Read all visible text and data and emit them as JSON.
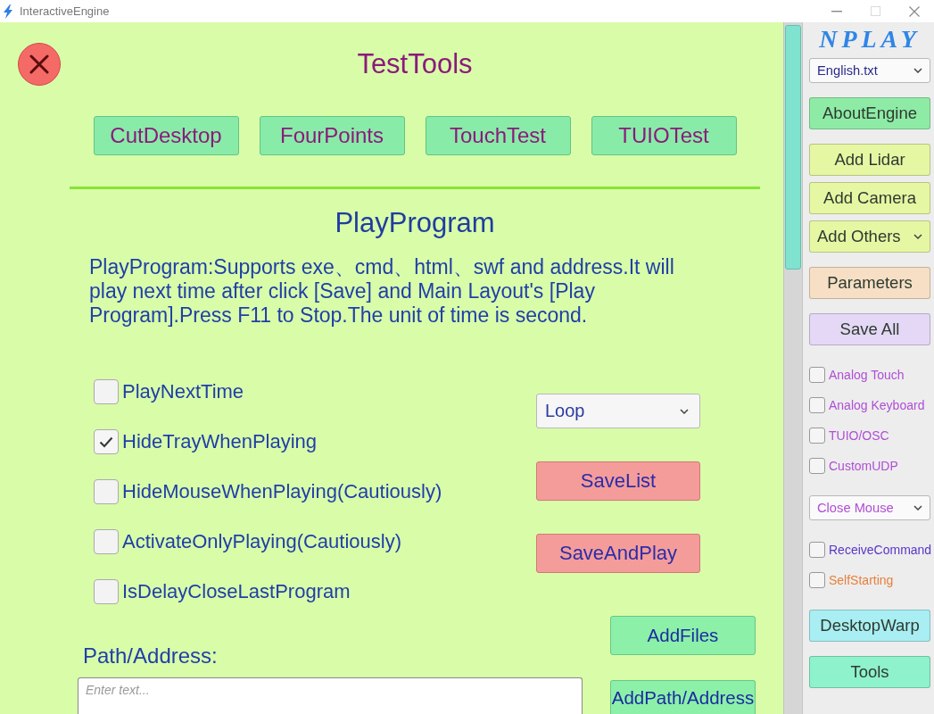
{
  "window": {
    "title": "InteractiveEngine",
    "controls": [
      {
        "kind": "minimize",
        "disabled": false
      },
      {
        "kind": "maximize",
        "disabled": true
      },
      {
        "kind": "close",
        "disabled": false
      }
    ]
  },
  "test_tools": {
    "title": "TestTools",
    "buttons": [
      "CutDesktop",
      "FourPoints",
      "TouchTest",
      "TUIOTest"
    ]
  },
  "play_program": {
    "title": "PlayProgram",
    "description": "PlayProgram:Supports exe、cmd、html、swf and address.It will play next time after click [Save] and Main Layout's [Play Program].Press F11 to Stop.The unit of time is second.",
    "options": [
      {
        "label": "PlayNextTime",
        "checked": false
      },
      {
        "label": "HideTrayWhenPlaying",
        "checked": true
      },
      {
        "label": "HideMouseWhenPlaying(Cautiously)",
        "checked": false
      },
      {
        "label": "ActivateOnlyPlaying(Cautiously)",
        "checked": false
      },
      {
        "label": "IsDelayCloseLastProgram",
        "checked": false
      }
    ],
    "mode_select": {
      "value": "Loop"
    },
    "actions": [
      "SaveList",
      "SaveAndPlay"
    ],
    "path_label": "Path/Address:",
    "path_field": {
      "placeholder": "Enter text..."
    },
    "add_buttons": [
      "AddFiles",
      "AddPath/Address"
    ]
  },
  "sidebar": {
    "logo": "NPLAY",
    "sections": [
      {
        "items": [
          {
            "kind": "select",
            "value": "English.txt",
            "color": "#2a2a8c"
          }
        ]
      },
      {
        "items": [
          {
            "kind": "button",
            "label": "AboutEngine",
            "color": "#8eeba6"
          }
        ]
      },
      {
        "items": [
          {
            "kind": "button",
            "label": "Add Lidar",
            "color": "#e6f7a4"
          },
          {
            "kind": "button",
            "label": "Add Camera",
            "color": "#e6f7a4"
          },
          {
            "kind": "menu_button",
            "label": "Add Others",
            "color": "#e6f7a4"
          }
        ]
      },
      {
        "items": [
          {
            "kind": "button",
            "label": "Parameters",
            "color": "#f6dfc4"
          }
        ]
      },
      {
        "items": [
          {
            "kind": "button",
            "label": "Save All",
            "color": "#e4d8f6"
          }
        ]
      },
      {
        "items": [
          {
            "kind": "checkbox",
            "label": "Analog Touch",
            "checked": false,
            "color": "#b04ed6"
          },
          {
            "kind": "checkbox",
            "label": "Analog Keyboard",
            "checked": false,
            "color": "#b04ed6"
          },
          {
            "kind": "checkbox",
            "label": "TUIO/OSC",
            "checked": false,
            "color": "#b04ed6"
          },
          {
            "kind": "checkbox",
            "label": "CustomUDP",
            "checked": false,
            "color": "#b04ed6"
          }
        ]
      },
      {
        "items": [
          {
            "kind": "select",
            "value": "Close Mouse",
            "color": "#b04ed6"
          }
        ]
      },
      {
        "items": [
          {
            "kind": "checkbox",
            "label": "ReceiveCommand",
            "checked": false,
            "color": "#5a36c8"
          },
          {
            "kind": "checkbox",
            "label": "SelfStarting",
            "checked": false,
            "color": "#e8803c"
          }
        ]
      },
      {
        "items": [
          {
            "kind": "button",
            "label": "DesktopWarp",
            "color": "#a8eef2"
          }
        ]
      },
      {
        "items": [
          {
            "kind": "button",
            "label": "Tools",
            "color": "#8ef2cc"
          }
        ]
      }
    ]
  }
}
